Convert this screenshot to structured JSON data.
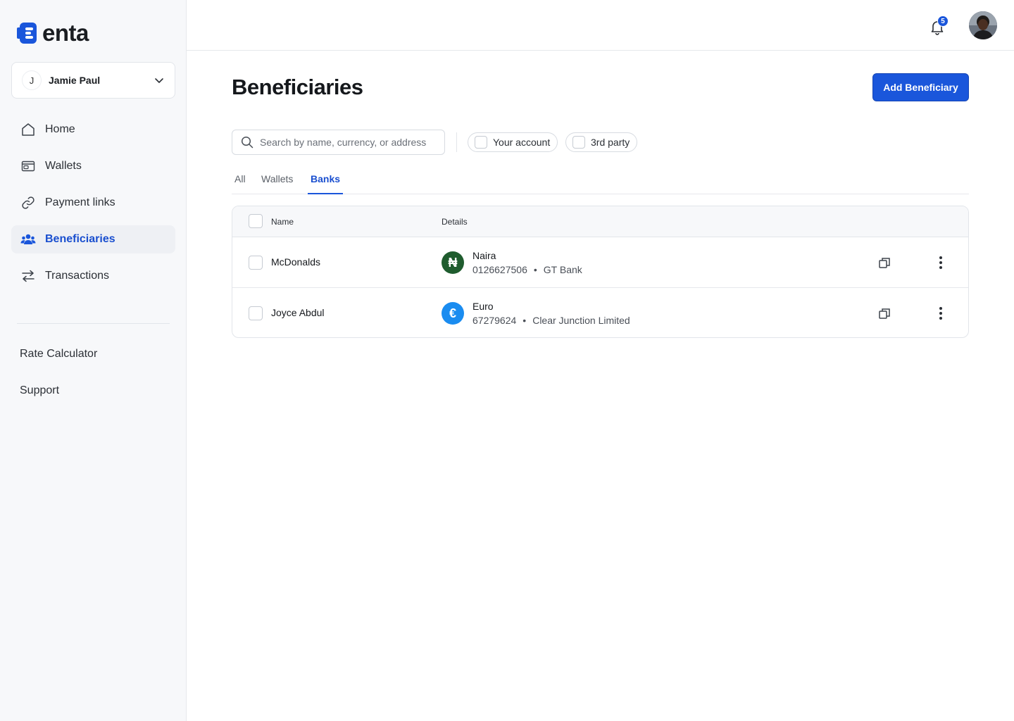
{
  "brand": {
    "name": "enta",
    "accent": "#1a56db"
  },
  "account": {
    "initial": "J",
    "name": "Jamie Paul"
  },
  "nav": [
    {
      "label": "Home",
      "icon": "home-icon",
      "active": false
    },
    {
      "label": "Wallets",
      "icon": "wallet-icon",
      "active": false
    },
    {
      "label": "Payment links",
      "icon": "link-icon",
      "active": false
    },
    {
      "label": "Beneficiaries",
      "icon": "users-icon",
      "active": true
    },
    {
      "label": "Transactions",
      "icon": "transfer-icon",
      "active": false
    }
  ],
  "secondary_nav": {
    "rate_calculator": "Rate Calculator",
    "support": "Support"
  },
  "topbar": {
    "notification_count": "5"
  },
  "page": {
    "title": "Beneficiaries",
    "add_button": "Add Beneficiary"
  },
  "search": {
    "placeholder": "Search by name, currency, or address",
    "value": ""
  },
  "filters": {
    "your_account": "Your account",
    "third_party": "3rd party"
  },
  "tabs": [
    {
      "label": "All",
      "active": false
    },
    {
      "label": "Wallets",
      "active": false
    },
    {
      "label": "Banks",
      "active": true
    }
  ],
  "table": {
    "columns": {
      "name": "Name",
      "details": "Details"
    },
    "rows": [
      {
        "name": "McDonalds",
        "currency": "Naira",
        "currency_symbol": "₦",
        "currency_color": "#1f5c2e",
        "account_number": "0126627506",
        "bank": "GT Bank"
      },
      {
        "name": "Joyce Abdul",
        "currency": "Euro",
        "currency_symbol": "€",
        "currency_color": "#1a8cf0",
        "account_number": "67279624",
        "bank": "Clear Junction Limited"
      }
    ]
  }
}
